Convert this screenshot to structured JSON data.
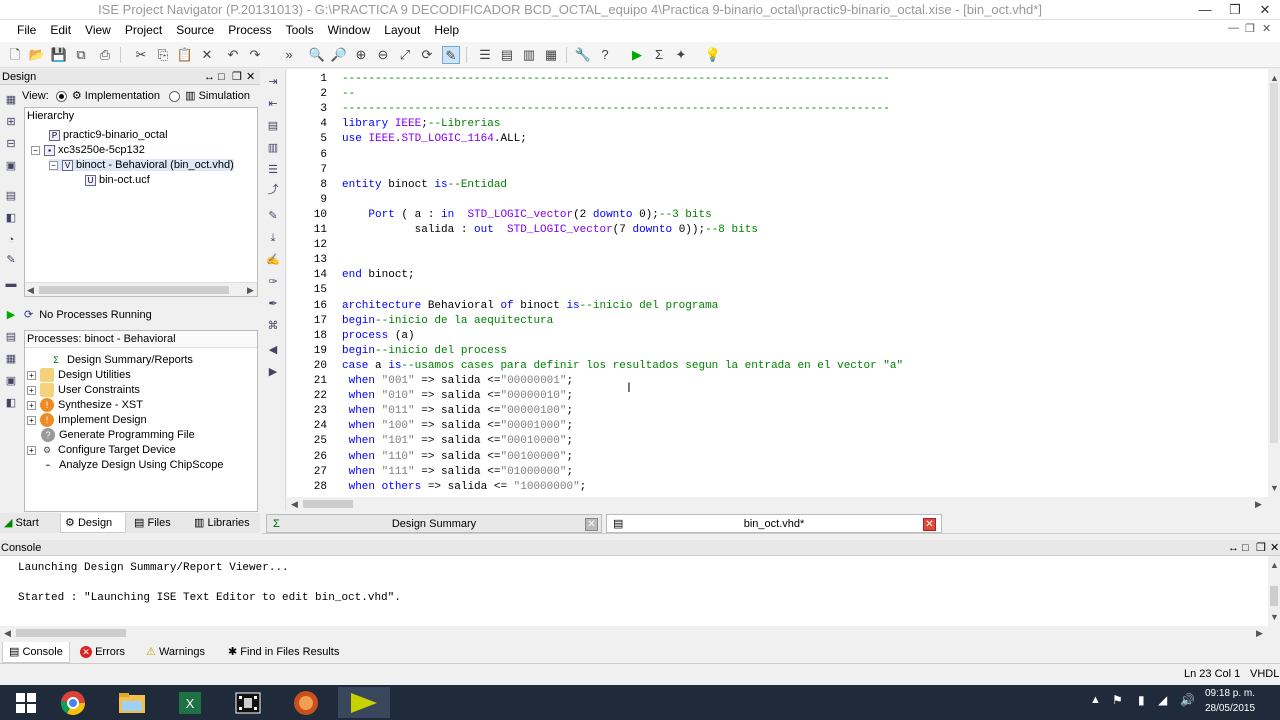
{
  "window": {
    "title": "ISE Project Navigator (P.20131013) - G:\\PRACTICA 9 DECODIFICADOR BCD_OCTAL_equipo 4\\Practica 9-binario_octal\\practic9-binario_octal.xise - [bin_oct.vhd*]",
    "minimize": "—",
    "maximize": "❐",
    "close": "✕"
  },
  "menu": [
    "File",
    "Edit",
    "View",
    "Project",
    "Source",
    "Process",
    "Tools",
    "Window",
    "Layout",
    "Help"
  ],
  "design_panel": {
    "header": "Design",
    "view_label": "View:",
    "implementation_label": "Implementation",
    "simulation_label": "Simulation",
    "hierarchy_label": "Hierarchy",
    "tree": [
      {
        "label": "practic9-binario_octal",
        "icon": "project-icon"
      },
      {
        "label": "xc3s250e-5cp132",
        "icon": "chip-icon"
      },
      {
        "label": "binoct - Behavioral (bin_oct.vhd)",
        "icon": "vhdl-module-icon"
      },
      {
        "label": "bin-oct.ucf",
        "icon": "constraint-file-icon"
      }
    ]
  },
  "process_panel": {
    "status": "No Processes Running",
    "title": "Processes: binoct - Behavioral",
    "items": [
      {
        "label": "Design Summary/Reports",
        "icon": "sigma-icon",
        "expand": false
      },
      {
        "label": "Design Utilities",
        "icon": "folder-icon",
        "expand": true
      },
      {
        "label": "User Constraints",
        "icon": "folder-icon",
        "expand": true
      },
      {
        "label": "Synthesize - XST",
        "icon": "warning-run-icon",
        "expand": true
      },
      {
        "label": "Implement Design",
        "icon": "warning-run-icon",
        "expand": true
      },
      {
        "label": "Generate Programming File",
        "icon": "question-run-icon",
        "expand": false
      },
      {
        "label": "Configure Target Device",
        "icon": "device-icon",
        "expand": true
      },
      {
        "label": "Analyze Design Using ChipScope",
        "icon": "chipscope-icon",
        "expand": false
      }
    ]
  },
  "left_tabs": [
    "Start",
    "Design",
    "Files",
    "Libraries"
  ],
  "doc_tabs": [
    "Design Summary",
    "bin_oct.vhd*"
  ],
  "editor": {
    "lines": [
      {
        "n": "1",
        "t": "-----------------------------------------------------------------------------------",
        "c": "comment"
      },
      {
        "n": "2",
        "t": "--",
        "c": "comment"
      },
      {
        "n": "3",
        "t": "-----------------------------------------------------------------------------------",
        "c": "comment"
      },
      {
        "n": "4",
        "t": "library IEEE;--Librerias",
        "c": "mixed"
      },
      {
        "n": "5",
        "t": "use IEEE.STD_LOGIC_1164.ALL;",
        "c": "mixed"
      },
      {
        "n": "6",
        "t": "",
        "c": "plain"
      },
      {
        "n": "7",
        "t": "",
        "c": "plain"
      },
      {
        "n": "8",
        "t": "entity binoct is--Entidad",
        "c": "mixed"
      },
      {
        "n": "9",
        "t": "",
        "c": "plain"
      },
      {
        "n": "10",
        "t": "    Port ( a : in  STD_LOGIC_vector(2 downto 0);--3 bits",
        "c": "mixed"
      },
      {
        "n": "11",
        "t": "           salida : out  STD_LOGIC_vector(7 downto 0));--8 bits",
        "c": "mixed"
      },
      {
        "n": "12",
        "t": "",
        "c": "plain"
      },
      {
        "n": "13",
        "t": "",
        "c": "plain"
      },
      {
        "n": "14",
        "t": "end binoct;",
        "c": "mixed"
      },
      {
        "n": "15",
        "t": "",
        "c": "plain"
      },
      {
        "n": "16",
        "t": "architecture Behavioral of binoct is--inicio del programa",
        "c": "mixed"
      },
      {
        "n": "17",
        "t": "begin--inicio de la aequitectura",
        "c": "mixed"
      },
      {
        "n": "18",
        "t": "process (a)",
        "c": "mixed"
      },
      {
        "n": "19",
        "t": "begin--inicio del process",
        "c": "mixed"
      },
      {
        "n": "20",
        "t": "case a is--usamos cases para definir los resultados segun la entrada en el vector \"a\"",
        "c": "mixed"
      },
      {
        "n": "21",
        "t": " when \"001\" => salida <=\"00000001\";",
        "c": "mixed"
      },
      {
        "n": "22",
        "t": " when \"010\" => salida <=\"00000010\";",
        "c": "mixed"
      },
      {
        "n": "23",
        "t": " when \"011\" => salida <=\"00000100\";",
        "c": "mixed"
      },
      {
        "n": "24",
        "t": " when \"100\" => salida <=\"00001000\";",
        "c": "mixed"
      },
      {
        "n": "25",
        "t": " when \"101\" => salida <=\"00010000\";",
        "c": "mixed"
      },
      {
        "n": "26",
        "t": " when \"110\" => salida <=\"00100000\";",
        "c": "mixed"
      },
      {
        "n": "27",
        "t": " when \"111\" => salida <=\"01000000\";",
        "c": "mixed"
      },
      {
        "n": "28",
        "t": " when others => salida <= \"10000000\";",
        "c": "mixed"
      }
    ]
  },
  "console": {
    "header": "Console",
    "lines": [
      "Launching Design Summary/Report Viewer...",
      "",
      "Started : \"Launching ISE Text Editor to edit bin_oct.vhd\"."
    ]
  },
  "console_tabs": [
    "Console",
    "Errors",
    "Warnings",
    "Find in Files Results"
  ],
  "status": {
    "position": "Ln 23 Col 1",
    "language": "VHDL"
  },
  "taskbar": {
    "time": "09:18 p. m.",
    "date": "28/05/2015"
  },
  "colors": {
    "keyword": "#0000ff",
    "comment": "#008000",
    "string": "#808080",
    "type": "#8000ff",
    "plain": "#000000",
    "taskbar_bg": "#1f2a3a"
  }
}
